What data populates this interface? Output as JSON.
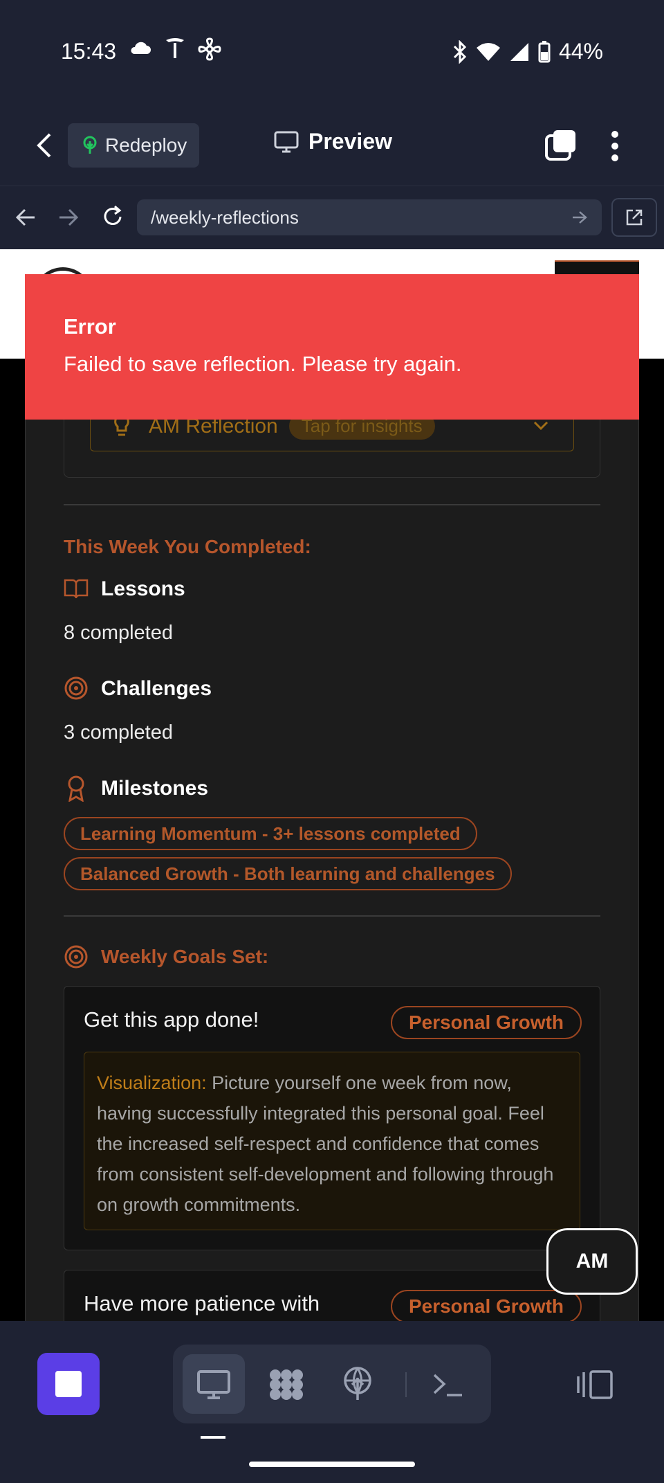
{
  "status_bar": {
    "time": "15:43",
    "battery": "44%"
  },
  "browser": {
    "redeploy_label": "Redeploy",
    "title": "Preview",
    "url": "/weekly-reflections"
  },
  "toast": {
    "title": "Error",
    "message": "Failed to save reflection. Please try again."
  },
  "reflection": {
    "label": "AM Reflection",
    "badge": "Tap for insights"
  },
  "completed": {
    "heading": "This Week You Completed:",
    "lessons_label": "Lessons",
    "lessons_value": "8 completed",
    "challenges_label": "Challenges",
    "challenges_value": "3 completed",
    "milestones_label": "Milestones",
    "milestones": [
      "Learning Momentum - 3+ lessons completed",
      "Balanced Growth - Both learning and challenges"
    ]
  },
  "goals": {
    "heading": "Weekly Goals Set:",
    "items": [
      {
        "title": "Get this app done!",
        "category": "Personal Growth",
        "viz_label": "Visualization:",
        "viz_text": "Picture yourself one week from now, having successfully integrated this personal goal. Feel the increased self-respect and confidence that comes from consistent self-development and following through on growth commitments."
      },
      {
        "title": "Have more patience with",
        "category": "Personal Growth"
      }
    ]
  },
  "fab_label": "AM",
  "colors": {
    "accent": "#b6562c",
    "error": "#ef4444",
    "gold": "#c07e19",
    "stop": "#5b3ee6"
  }
}
